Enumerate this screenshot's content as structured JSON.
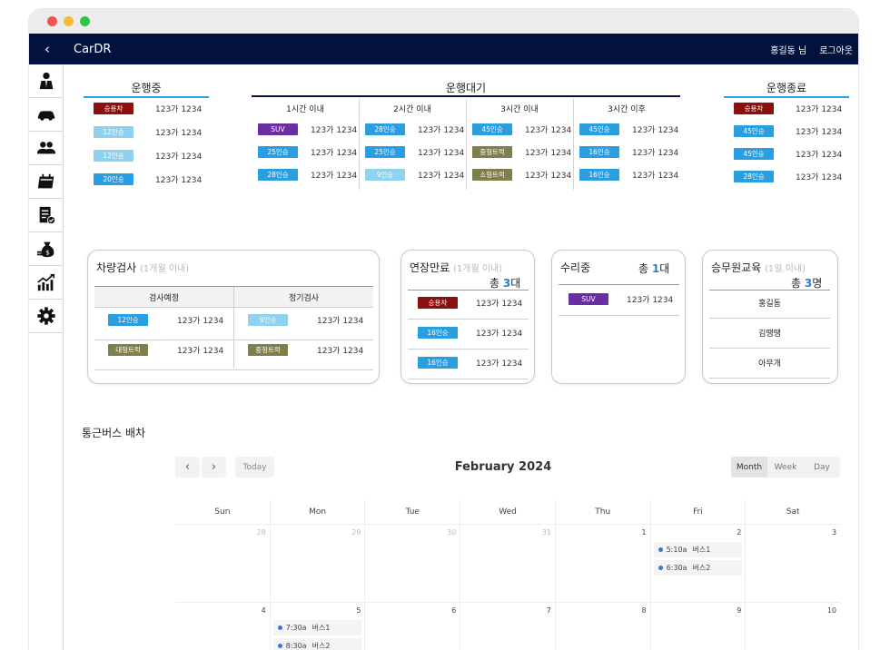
{
  "app": {
    "title": "CarDR",
    "back_icon": "chevron-left-icon",
    "user": "홍길동 님",
    "logout": "로그아웃"
  },
  "sidebar": {
    "items": [
      {
        "icon": "driver-icon"
      },
      {
        "icon": "car-icon"
      },
      {
        "icon": "users-icon"
      },
      {
        "icon": "calendar-icon"
      },
      {
        "icon": "checklist-icon"
      },
      {
        "icon": "money-icon"
      },
      {
        "icon": "chart-icon"
      },
      {
        "icon": "gear-icon"
      }
    ]
  },
  "status": {
    "running": {
      "title": "운행중",
      "rows": [
        {
          "badge": "승용차",
          "color": "red",
          "plate": "123가 1234"
        },
        {
          "badge": "12인승",
          "color": "lblue",
          "plate": "123가 1234"
        },
        {
          "badge": "12인승",
          "color": "lblue",
          "plate": "123가 1234"
        },
        {
          "badge": "20인승",
          "color": "blue",
          "plate": "123가 1234"
        }
      ]
    },
    "waiting": {
      "title": "운행대기",
      "columns": [
        {
          "label": "1시간 이내",
          "rows": [
            {
              "badge": "SUV",
              "color": "purple",
              "plate": "123가 1234"
            },
            {
              "badge": "25인승",
              "color": "blue",
              "plate": "123가 1234"
            },
            {
              "badge": "28인승",
              "color": "blue",
              "plate": "123가 1234"
            }
          ]
        },
        {
          "label": "2시간 이내",
          "rows": [
            {
              "badge": "28인승",
              "color": "blue",
              "plate": "123가 1234"
            },
            {
              "badge": "25인승",
              "color": "blue",
              "plate": "123가 1234"
            },
            {
              "badge": "9인승",
              "color": "lblue",
              "plate": "123가 1234"
            }
          ]
        },
        {
          "label": "3시간 이내",
          "rows": [
            {
              "badge": "45인승",
              "color": "blue",
              "plate": "123가 1234"
            },
            {
              "badge": "중형트럭",
              "color": "olive",
              "plate": "123가 1234"
            },
            {
              "badge": "소형트럭",
              "color": "olive",
              "plate": "123가 1234"
            }
          ]
        },
        {
          "label": "3시간 이후",
          "rows": [
            {
              "badge": "45인승",
              "color": "blue",
              "plate": "123가 1234"
            },
            {
              "badge": "16인승",
              "color": "blue",
              "plate": "123가 1234"
            },
            {
              "badge": "16인승",
              "color": "blue",
              "plate": "123가 1234"
            }
          ]
        }
      ]
    },
    "finished": {
      "title": "운행종료",
      "rows": [
        {
          "badge": "승용차",
          "color": "red",
          "plate": "123가 1234"
        },
        {
          "badge": "45인승",
          "color": "blue",
          "plate": "123가 1234"
        },
        {
          "badge": "45인승",
          "color": "blue",
          "plate": "123가 1234"
        },
        {
          "badge": "28인승",
          "color": "blue",
          "plate": "123가 1234"
        }
      ]
    }
  },
  "inspection": {
    "title": "차량검사",
    "sub": "(1개월 이내)",
    "col1": "검사예정",
    "col2": "정기검사",
    "rows": [
      {
        "b1": "12인승",
        "c1": "blue",
        "p1": "123가 1234",
        "b2": "9인승",
        "c2": "lblue",
        "p2": "123가 1234"
      },
      {
        "b1": "대형트럭",
        "c1": "olive",
        "p1": "123가 1234",
        "b2": "중형트럭",
        "c2": "olive",
        "p2": "123가 1234"
      }
    ]
  },
  "extension": {
    "title": "연장만료",
    "sub": "(1개월 이내)",
    "total_prefix": "총 ",
    "total": "3",
    "unit": "대",
    "rows": [
      {
        "badge": "승용차",
        "color": "red",
        "plate": "123가 1234"
      },
      {
        "badge": "16인승",
        "color": "blue",
        "plate": "123가 1234"
      },
      {
        "badge": "16인승",
        "color": "blue",
        "plate": "123가 1234"
      }
    ]
  },
  "repair": {
    "title": "수리중",
    "total_prefix": "총 ",
    "total": "1",
    "unit": "대",
    "rows": [
      {
        "badge": "SUV",
        "color": "purple",
        "plate": "123가 1234"
      }
    ]
  },
  "training": {
    "title": "승무원교육",
    "sub": "(1일 이내)",
    "total_prefix": "총 ",
    "total": "3",
    "unit": "명",
    "names": [
      "홍길동",
      "김땡땡",
      "아무개"
    ]
  },
  "calendar": {
    "section_title": "통근버스 배차",
    "title": "February 2024",
    "prev": "‹",
    "next": "›",
    "today": "Today",
    "views": [
      "Month",
      "Week",
      "Day"
    ],
    "active_view": "Month",
    "weekdays": [
      "Sun",
      "Mon",
      "Tue",
      "Wed",
      "Thu",
      "Fri",
      "Sat"
    ],
    "weeks": [
      [
        {
          "d": "28",
          "muted": true
        },
        {
          "d": "29",
          "muted": true
        },
        {
          "d": "30",
          "muted": true
        },
        {
          "d": "31",
          "muted": true
        },
        {
          "d": "1"
        },
        {
          "d": "2",
          "events": [
            {
              "time": "5:10a",
              "name": "버스1"
            },
            {
              "time": "6:30a",
              "name": "버스2"
            }
          ]
        },
        {
          "d": "3"
        }
      ],
      [
        {
          "d": "4"
        },
        {
          "d": "5",
          "events": [
            {
              "time": "7:30a",
              "name": "버스1"
            },
            {
              "time": "8:30a",
              "name": "버스2"
            }
          ]
        },
        {
          "d": "6"
        },
        {
          "d": "7"
        },
        {
          "d": "8"
        },
        {
          "d": "9"
        },
        {
          "d": "10"
        }
      ]
    ]
  }
}
